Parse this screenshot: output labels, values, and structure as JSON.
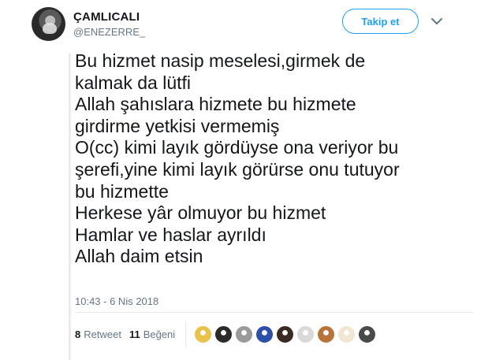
{
  "user": {
    "display_name": "ÇAMLICALI",
    "handle": "@ENEZERRE_"
  },
  "actions": {
    "follow_label": "Takip et",
    "menu_icon": "chevron-down-icon"
  },
  "tweet": {
    "lines": [
      "Bu hizmet nasip meselesi,girmek de",
      "kalmak da lütfi",
      "Allah şahıslara hizmete bu hizmete",
      "girdirme yetkisi vermemiş",
      "O(cc) kimi layık gördüyse ona veriyor bu",
      "şerefi,yine kimi layık görürse onu tutuyor",
      "bu hizmette",
      "Herkese yâr olmuyor bu hizmet",
      "Hamlar ve haslar ayrıldı",
      "Allah daim etsin"
    ],
    "timestamp": "10:43 - 6 Nis 2018"
  },
  "stats": {
    "retweet_count": "8",
    "retweet_label": "Retweet",
    "like_count": "11",
    "like_label": "Beğeni"
  },
  "colors": {
    "accent": "#1da1f2",
    "muted": "#657786",
    "text": "#14171a",
    "border": "#e6ecf0"
  },
  "liker_avatars": [
    {
      "name": "liker-avatar-1",
      "color": "#e8c24a"
    },
    {
      "name": "liker-avatar-2",
      "color": "#2b2b2b"
    },
    {
      "name": "liker-avatar-3",
      "color": "#9a9a9a"
    },
    {
      "name": "liker-avatar-4",
      "color": "#2d4fa8"
    },
    {
      "name": "liker-avatar-5",
      "color": "#3a2a22"
    },
    {
      "name": "liker-avatar-6",
      "color": "#d9d9d9"
    },
    {
      "name": "liker-avatar-7",
      "color": "#b8733a"
    },
    {
      "name": "liker-avatar-8",
      "color": "#f0e6d2"
    },
    {
      "name": "liker-avatar-9",
      "color": "#4a4a4a"
    }
  ]
}
